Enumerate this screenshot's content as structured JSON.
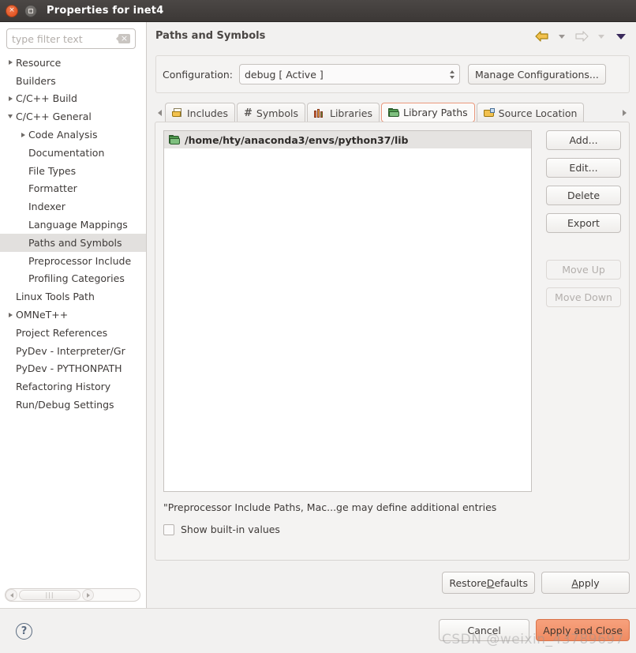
{
  "window": {
    "title": "Properties for inet4",
    "close_icon": "close-icon",
    "maximize_icon": "maximize-icon"
  },
  "sidebar": {
    "filter": {
      "placeholder": "type filter text",
      "value": "",
      "clear_icon": "clear-icon"
    },
    "items": [
      {
        "label": "Resource",
        "level": 0,
        "arrow": "right",
        "selected": false
      },
      {
        "label": "Builders",
        "level": 0,
        "arrow": "none",
        "selected": false
      },
      {
        "label": "C/C++ Build",
        "level": 0,
        "arrow": "right",
        "selected": false
      },
      {
        "label": "C/C++ General",
        "level": 0,
        "arrow": "down",
        "selected": false
      },
      {
        "label": "Code Analysis",
        "level": 1,
        "arrow": "right",
        "selected": false
      },
      {
        "label": "Documentation",
        "level": 1,
        "arrow": "none",
        "selected": false
      },
      {
        "label": "File Types",
        "level": 1,
        "arrow": "none",
        "selected": false
      },
      {
        "label": "Formatter",
        "level": 1,
        "arrow": "none",
        "selected": false
      },
      {
        "label": "Indexer",
        "level": 1,
        "arrow": "none",
        "selected": false
      },
      {
        "label": "Language Mappings",
        "level": 1,
        "arrow": "none",
        "selected": false
      },
      {
        "label": "Paths and Symbols",
        "level": 1,
        "arrow": "none",
        "selected": true
      },
      {
        "label": "Preprocessor Include",
        "level": 1,
        "arrow": "none",
        "selected": false
      },
      {
        "label": "Profiling Categories",
        "level": 1,
        "arrow": "none",
        "selected": false
      },
      {
        "label": "Linux Tools Path",
        "level": 0,
        "arrow": "none",
        "selected": false
      },
      {
        "label": "OMNeT++",
        "level": 0,
        "arrow": "right",
        "selected": false
      },
      {
        "label": "Project References",
        "level": 0,
        "arrow": "none",
        "selected": false
      },
      {
        "label": "PyDev - Interpreter/Gr",
        "level": 0,
        "arrow": "none",
        "selected": false
      },
      {
        "label": "PyDev - PYTHONPATH",
        "level": 0,
        "arrow": "none",
        "selected": false
      },
      {
        "label": "Refactoring History",
        "level": 0,
        "arrow": "none",
        "selected": false
      },
      {
        "label": "Run/Debug Settings",
        "level": 0,
        "arrow": "none",
        "selected": false
      }
    ]
  },
  "page": {
    "title": "Paths and Symbols",
    "nav": {
      "back_icon": "back-arrow-icon",
      "back_menu_icon": "chevron-down-icon",
      "forward_icon": "forward-arrow-icon",
      "forward_menu_icon": "chevron-down-icon",
      "view_menu_icon": "chevron-down-icon"
    }
  },
  "configuration": {
    "label": "Configuration:",
    "value": "debug  [ Active ]",
    "spinner_icon": "spinner-updown-icon",
    "manage_button": "Manage Configurations..."
  },
  "tabs": {
    "scroll_left_icon": "scroll-left-icon",
    "scroll_right_icon": "scroll-right-icon",
    "items": [
      {
        "label": "Includes",
        "icon": "includes-folder-icon",
        "active": false
      },
      {
        "label": "Symbols",
        "icon": "hash-icon",
        "active": false
      },
      {
        "label": "Libraries",
        "icon": "books-icon",
        "active": false
      },
      {
        "label": "Library Paths",
        "icon": "folder-green-icon",
        "active": true
      },
      {
        "label": "Source Location",
        "icon": "source-folder-icon",
        "active": false
      }
    ],
    "active_border_color": "#e8967a"
  },
  "list": {
    "rows": [
      {
        "icon": "folder-green-icon",
        "text": "/home/hty/anaconda3/envs/python37/lib",
        "selected": true
      }
    ]
  },
  "side_buttons": [
    {
      "label": "Add...",
      "enabled": true
    },
    {
      "label": "Edit...",
      "enabled": true
    },
    {
      "label": "Delete",
      "enabled": true
    },
    {
      "label": "Export",
      "enabled": true
    },
    {
      "label": "Move Up",
      "enabled": false
    },
    {
      "label": "Move Down",
      "enabled": false
    }
  ],
  "note": "\"Preprocessor Include Paths, Mac...ge may define additional entries",
  "builtin_checkbox": {
    "label": "Show built-in values",
    "checked": false
  },
  "panel_buttons": [
    {
      "label": "Restore Defaults",
      "mnemonic": "D"
    },
    {
      "label": "Apply",
      "mnemonic": "A"
    }
  ],
  "footer": {
    "help_icon": "help-icon",
    "cancel_label": "Cancel",
    "apply_close_label": "Apply and Close",
    "apply_close_color": "#ef8b62"
  },
  "watermark": "CSDN @weixin_43789697"
}
